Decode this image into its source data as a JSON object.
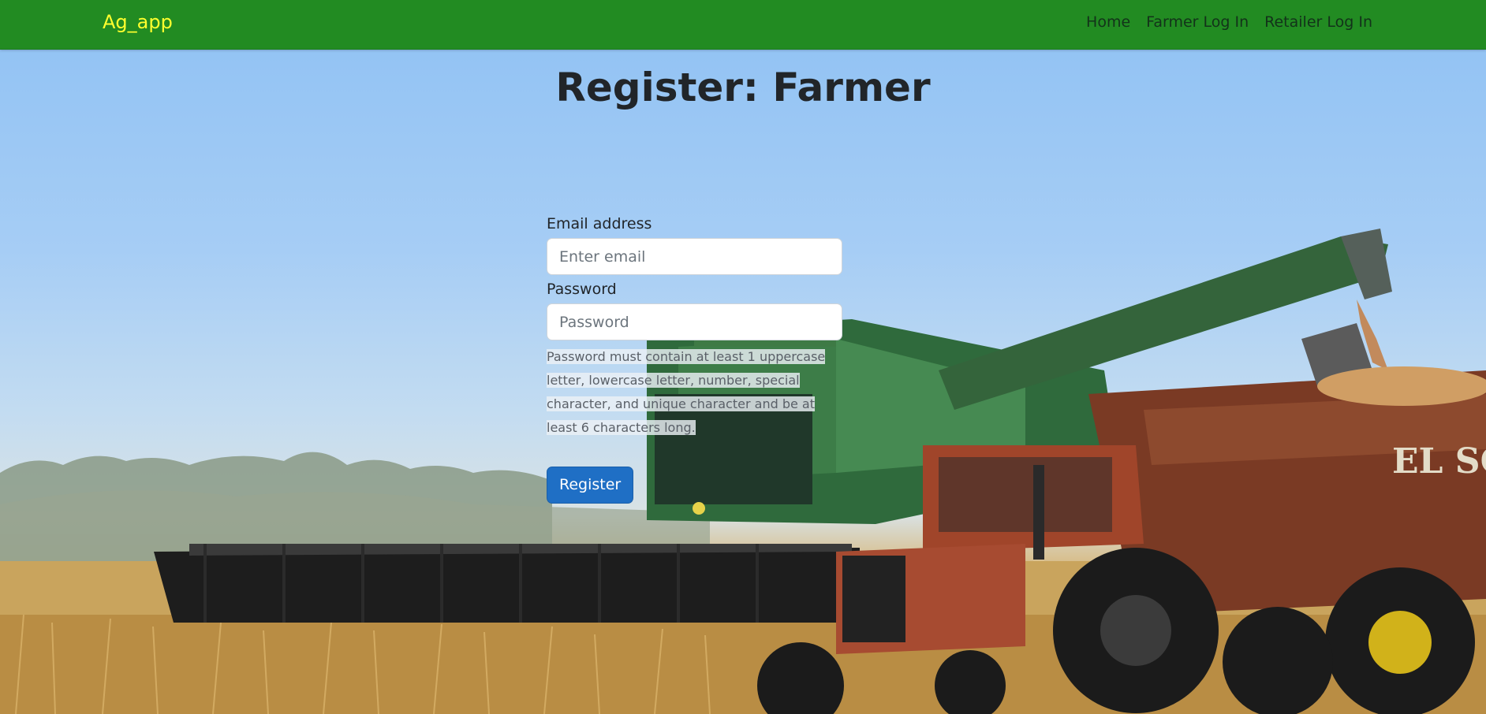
{
  "navbar": {
    "brand": "Ag_app",
    "links": [
      "Home",
      "Farmer Log In",
      "Retailer Log In"
    ]
  },
  "page": {
    "title": "Register: Farmer"
  },
  "form": {
    "email_label": "Email address",
    "email_placeholder": "Enter email",
    "password_label": "Password",
    "password_placeholder": "Password",
    "password_help": "Password must contain at least 1 uppercase letter, lowercase letter, number, special character, and unique character and be at least 6 characters long.",
    "submit_label": "Register"
  },
  "background": {
    "description_icon": "farm-harvest-background",
    "sign_text": "EL SOL"
  },
  "colors": {
    "navbar": "#228b22",
    "brand": "#ffff2e",
    "button": "#1f6fc5"
  }
}
